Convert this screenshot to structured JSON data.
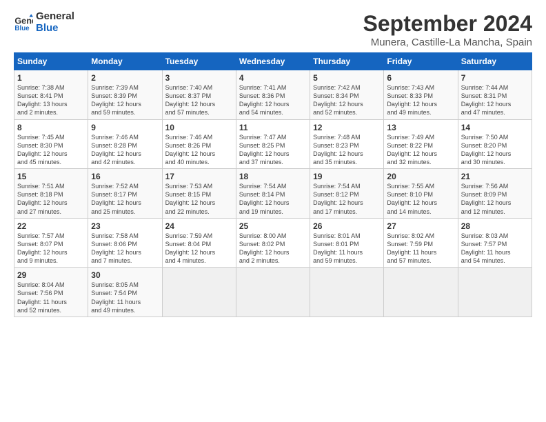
{
  "logo": {
    "line1": "General",
    "line2": "Blue"
  },
  "title": "September 2024",
  "subtitle": "Munera, Castille-La Mancha, Spain",
  "weekdays": [
    "Sunday",
    "Monday",
    "Tuesday",
    "Wednesday",
    "Thursday",
    "Friday",
    "Saturday"
  ],
  "weeks": [
    [
      {
        "day": "1",
        "info": "Sunrise: 7:38 AM\nSunset: 8:41 PM\nDaylight: 13 hours\nand 2 minutes."
      },
      {
        "day": "2",
        "info": "Sunrise: 7:39 AM\nSunset: 8:39 PM\nDaylight: 12 hours\nand 59 minutes."
      },
      {
        "day": "3",
        "info": "Sunrise: 7:40 AM\nSunset: 8:37 PM\nDaylight: 12 hours\nand 57 minutes."
      },
      {
        "day": "4",
        "info": "Sunrise: 7:41 AM\nSunset: 8:36 PM\nDaylight: 12 hours\nand 54 minutes."
      },
      {
        "day": "5",
        "info": "Sunrise: 7:42 AM\nSunset: 8:34 PM\nDaylight: 12 hours\nand 52 minutes."
      },
      {
        "day": "6",
        "info": "Sunrise: 7:43 AM\nSunset: 8:33 PM\nDaylight: 12 hours\nand 49 minutes."
      },
      {
        "day": "7",
        "info": "Sunrise: 7:44 AM\nSunset: 8:31 PM\nDaylight: 12 hours\nand 47 minutes."
      }
    ],
    [
      {
        "day": "8",
        "info": "Sunrise: 7:45 AM\nSunset: 8:30 PM\nDaylight: 12 hours\nand 45 minutes."
      },
      {
        "day": "9",
        "info": "Sunrise: 7:46 AM\nSunset: 8:28 PM\nDaylight: 12 hours\nand 42 minutes."
      },
      {
        "day": "10",
        "info": "Sunrise: 7:46 AM\nSunset: 8:26 PM\nDaylight: 12 hours\nand 40 minutes."
      },
      {
        "day": "11",
        "info": "Sunrise: 7:47 AM\nSunset: 8:25 PM\nDaylight: 12 hours\nand 37 minutes."
      },
      {
        "day": "12",
        "info": "Sunrise: 7:48 AM\nSunset: 8:23 PM\nDaylight: 12 hours\nand 35 minutes."
      },
      {
        "day": "13",
        "info": "Sunrise: 7:49 AM\nSunset: 8:22 PM\nDaylight: 12 hours\nand 32 minutes."
      },
      {
        "day": "14",
        "info": "Sunrise: 7:50 AM\nSunset: 8:20 PM\nDaylight: 12 hours\nand 30 minutes."
      }
    ],
    [
      {
        "day": "15",
        "info": "Sunrise: 7:51 AM\nSunset: 8:18 PM\nDaylight: 12 hours\nand 27 minutes."
      },
      {
        "day": "16",
        "info": "Sunrise: 7:52 AM\nSunset: 8:17 PM\nDaylight: 12 hours\nand 25 minutes."
      },
      {
        "day": "17",
        "info": "Sunrise: 7:53 AM\nSunset: 8:15 PM\nDaylight: 12 hours\nand 22 minutes."
      },
      {
        "day": "18",
        "info": "Sunrise: 7:54 AM\nSunset: 8:14 PM\nDaylight: 12 hours\nand 19 minutes."
      },
      {
        "day": "19",
        "info": "Sunrise: 7:54 AM\nSunset: 8:12 PM\nDaylight: 12 hours\nand 17 minutes."
      },
      {
        "day": "20",
        "info": "Sunrise: 7:55 AM\nSunset: 8:10 PM\nDaylight: 12 hours\nand 14 minutes."
      },
      {
        "day": "21",
        "info": "Sunrise: 7:56 AM\nSunset: 8:09 PM\nDaylight: 12 hours\nand 12 minutes."
      }
    ],
    [
      {
        "day": "22",
        "info": "Sunrise: 7:57 AM\nSunset: 8:07 PM\nDaylight: 12 hours\nand 9 minutes."
      },
      {
        "day": "23",
        "info": "Sunrise: 7:58 AM\nSunset: 8:06 PM\nDaylight: 12 hours\nand 7 minutes."
      },
      {
        "day": "24",
        "info": "Sunrise: 7:59 AM\nSunset: 8:04 PM\nDaylight: 12 hours\nand 4 minutes."
      },
      {
        "day": "25",
        "info": "Sunrise: 8:00 AM\nSunset: 8:02 PM\nDaylight: 12 hours\nand 2 minutes."
      },
      {
        "day": "26",
        "info": "Sunrise: 8:01 AM\nSunset: 8:01 PM\nDaylight: 11 hours\nand 59 minutes."
      },
      {
        "day": "27",
        "info": "Sunrise: 8:02 AM\nSunset: 7:59 PM\nDaylight: 11 hours\nand 57 minutes."
      },
      {
        "day": "28",
        "info": "Sunrise: 8:03 AM\nSunset: 7:57 PM\nDaylight: 11 hours\nand 54 minutes."
      }
    ],
    [
      {
        "day": "29",
        "info": "Sunrise: 8:04 AM\nSunset: 7:56 PM\nDaylight: 11 hours\nand 52 minutes."
      },
      {
        "day": "30",
        "info": "Sunrise: 8:05 AM\nSunset: 7:54 PM\nDaylight: 11 hours\nand 49 minutes."
      },
      {
        "day": "",
        "info": ""
      },
      {
        "day": "",
        "info": ""
      },
      {
        "day": "",
        "info": ""
      },
      {
        "day": "",
        "info": ""
      },
      {
        "day": "",
        "info": ""
      }
    ]
  ]
}
